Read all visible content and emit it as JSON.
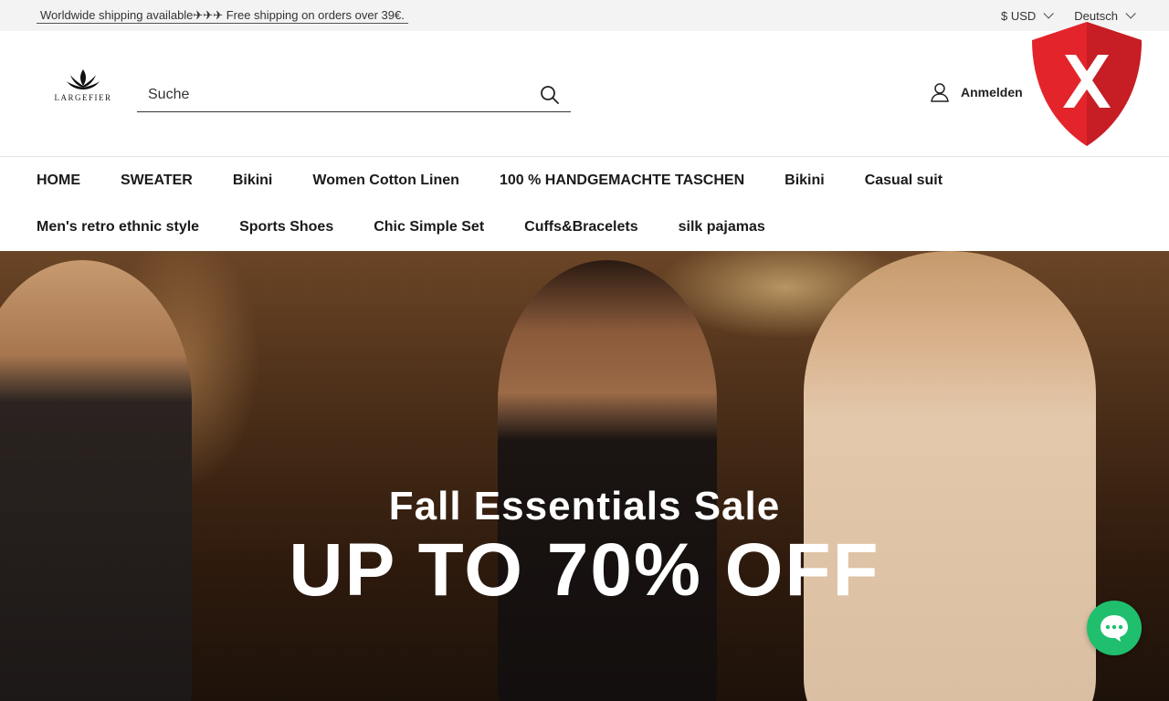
{
  "topbar": {
    "announcement": "Worldwide shipping available✈✈✈ Free shipping on orders over 39€.",
    "currency": "$ USD",
    "language": "Deutsch"
  },
  "header": {
    "logo_text": "LARGEFIER",
    "search_placeholder": "Suche",
    "login_label": "Anmelden"
  },
  "nav": {
    "row1": [
      "HOME",
      "SWEATER",
      "Bikini",
      "Women Cotton Linen",
      "100 % HANDGEMACHTE TASCHEN",
      "Bikini",
      "Casual suit"
    ],
    "row2": [
      "Men's retro ethnic style",
      "Sports Shoes",
      "Chic Simple Set",
      "Cuffs&Bracelets",
      "silk pajamas"
    ]
  },
  "hero": {
    "subtitle": "Fall Essentials Sale",
    "headline": "UP TO 70% OFF"
  },
  "colors": {
    "shield": "#e3242b",
    "chat": "#1fbf6e"
  },
  "icons": {
    "search": "search-icon",
    "user": "user-icon",
    "shield": "shield-x-icon",
    "chat": "chat-icon"
  }
}
